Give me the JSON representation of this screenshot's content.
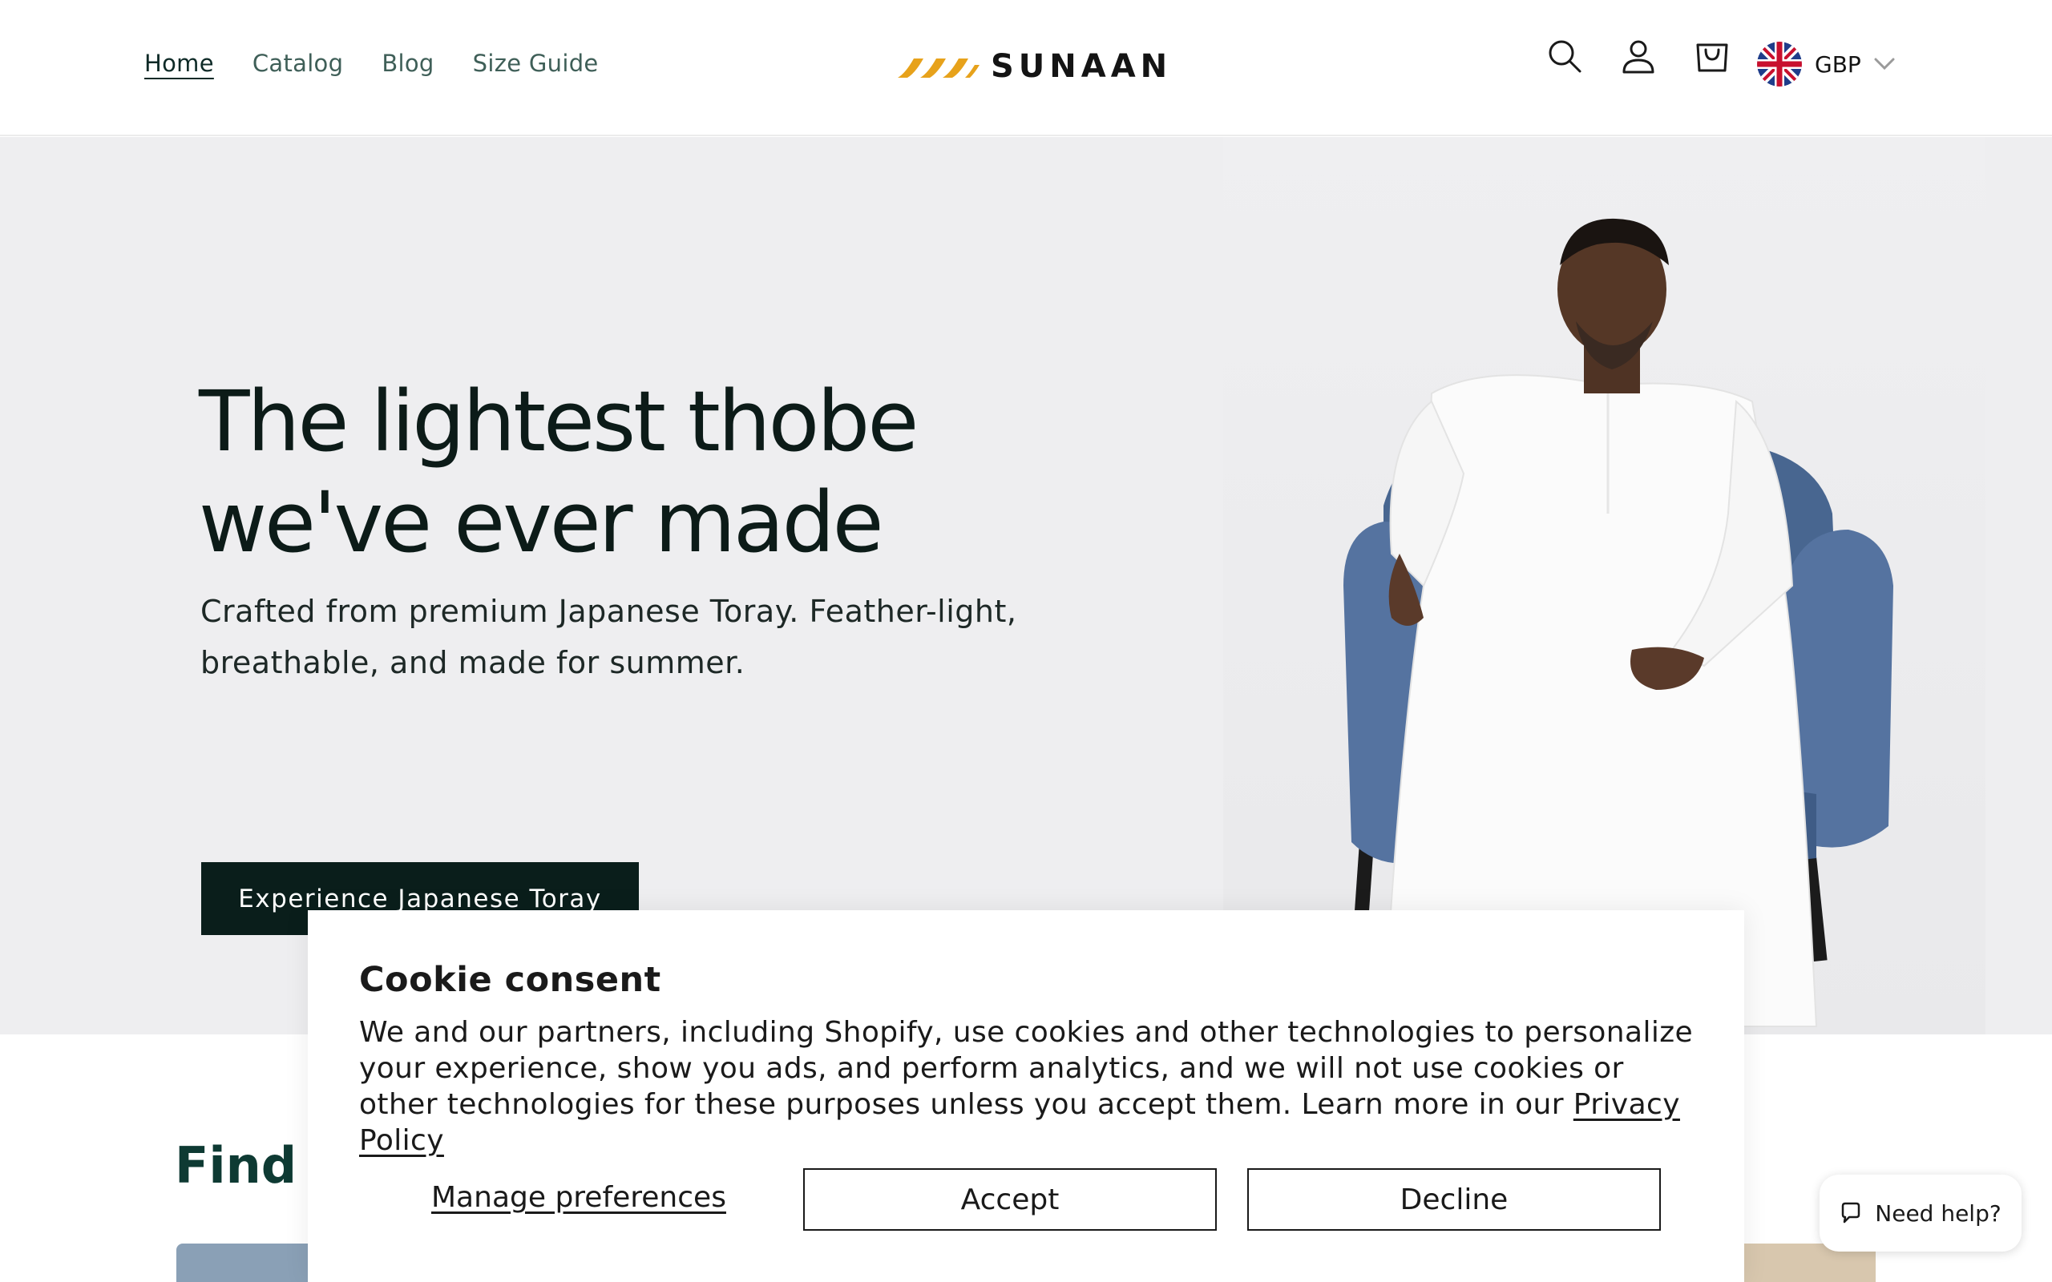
{
  "nav": {
    "items": [
      {
        "label": "Home",
        "active": true
      },
      {
        "label": "Catalog",
        "active": false
      },
      {
        "label": "Blog",
        "active": false
      },
      {
        "label": "Size Guide",
        "active": false
      }
    ]
  },
  "brand": {
    "name": "SUNAAN",
    "accent_color": "#e7a21b"
  },
  "header_icons": [
    "search-icon",
    "account-icon",
    "cart-icon"
  ],
  "currency": {
    "label": "GBP",
    "flag": "uk-flag-icon"
  },
  "hero": {
    "title": "The lightest thobe we've ever made",
    "subtitle": "Crafted from premium Japanese Toray. Feather-light, breathable, and made for summer.",
    "cta_label": "Experience Japanese Toray",
    "cta_color": "#0a1e1b"
  },
  "collections": {
    "title_partial": "Find Y"
  },
  "cookie": {
    "title": "Cookie consent",
    "body": "We and our partners, including Shopify, use cookies and other technologies to personalize your experience, show you ads, and perform analytics, and we will not use cookies or other technologies for these purposes unless you accept them. Learn more in our",
    "link_label": "Privacy Policy",
    "manage_label": "Manage preferences",
    "accept_label": "Accept",
    "decline_label": "Decline"
  },
  "help": {
    "label": "Need help?"
  }
}
